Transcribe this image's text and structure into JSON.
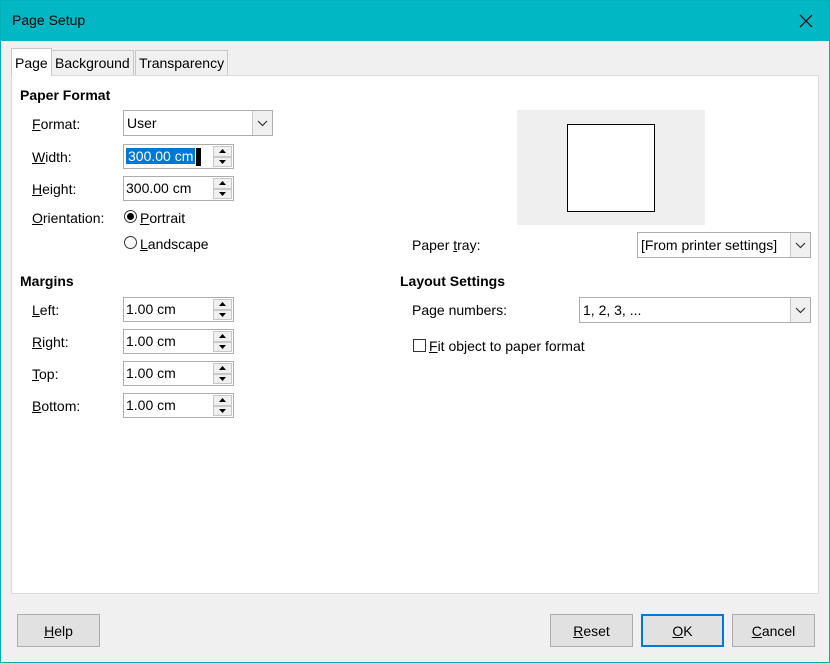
{
  "window": {
    "title": "Page Setup"
  },
  "tabs": [
    {
      "label": "Page",
      "active": true
    },
    {
      "label": "Background",
      "active": false
    },
    {
      "label": "Transparency",
      "active": false
    }
  ],
  "paper_format": {
    "title": "Paper Format",
    "format_label_u": "F",
    "format_label_rest": "ormat:",
    "format_value": "User",
    "width_label_u": "W",
    "width_label_rest": "idth:",
    "width_value": "300.00 cm",
    "height_label_u": "H",
    "height_label_rest": "eight:",
    "height_value": "300.00 cm",
    "orientation_label_u": "O",
    "orientation_label_rest": "rientation:",
    "portrait_u": "P",
    "portrait_rest": "ortrait",
    "landscape_u": "L",
    "landscape_rest": "andscape",
    "orientation_selected": "Portrait"
  },
  "paper_tray": {
    "label_pre": "Paper ",
    "label_u": "t",
    "label_rest": "ray:",
    "value": "[From printer settings]"
  },
  "margins": {
    "title": "Margins",
    "left_u": "L",
    "left_rest": "eft:",
    "left_value": "1.00 cm",
    "right_u": "R",
    "right_rest": "ight:",
    "right_value": "1.00 cm",
    "top_u": "T",
    "top_rest": "op:",
    "top_value": "1.00 cm",
    "bottom_u": "B",
    "bottom_rest": "ottom:",
    "bottom_value": "1.00 cm"
  },
  "layout_settings": {
    "title": "Layout Settings",
    "page_numbers_pre": "Pa",
    "page_numbers_u": "g",
    "page_numbers_rest": "e numbers:",
    "page_numbers_value": "1, 2, 3, ...",
    "fit_u": "F",
    "fit_rest": "it object to paper format",
    "fit_checked": false
  },
  "buttons": {
    "help_u": "H",
    "help_rest": "elp",
    "reset_u": "R",
    "reset_rest": "eset",
    "ok_u": "O",
    "ok_rest": "K",
    "cancel_u": "C",
    "cancel_rest": "ancel"
  }
}
